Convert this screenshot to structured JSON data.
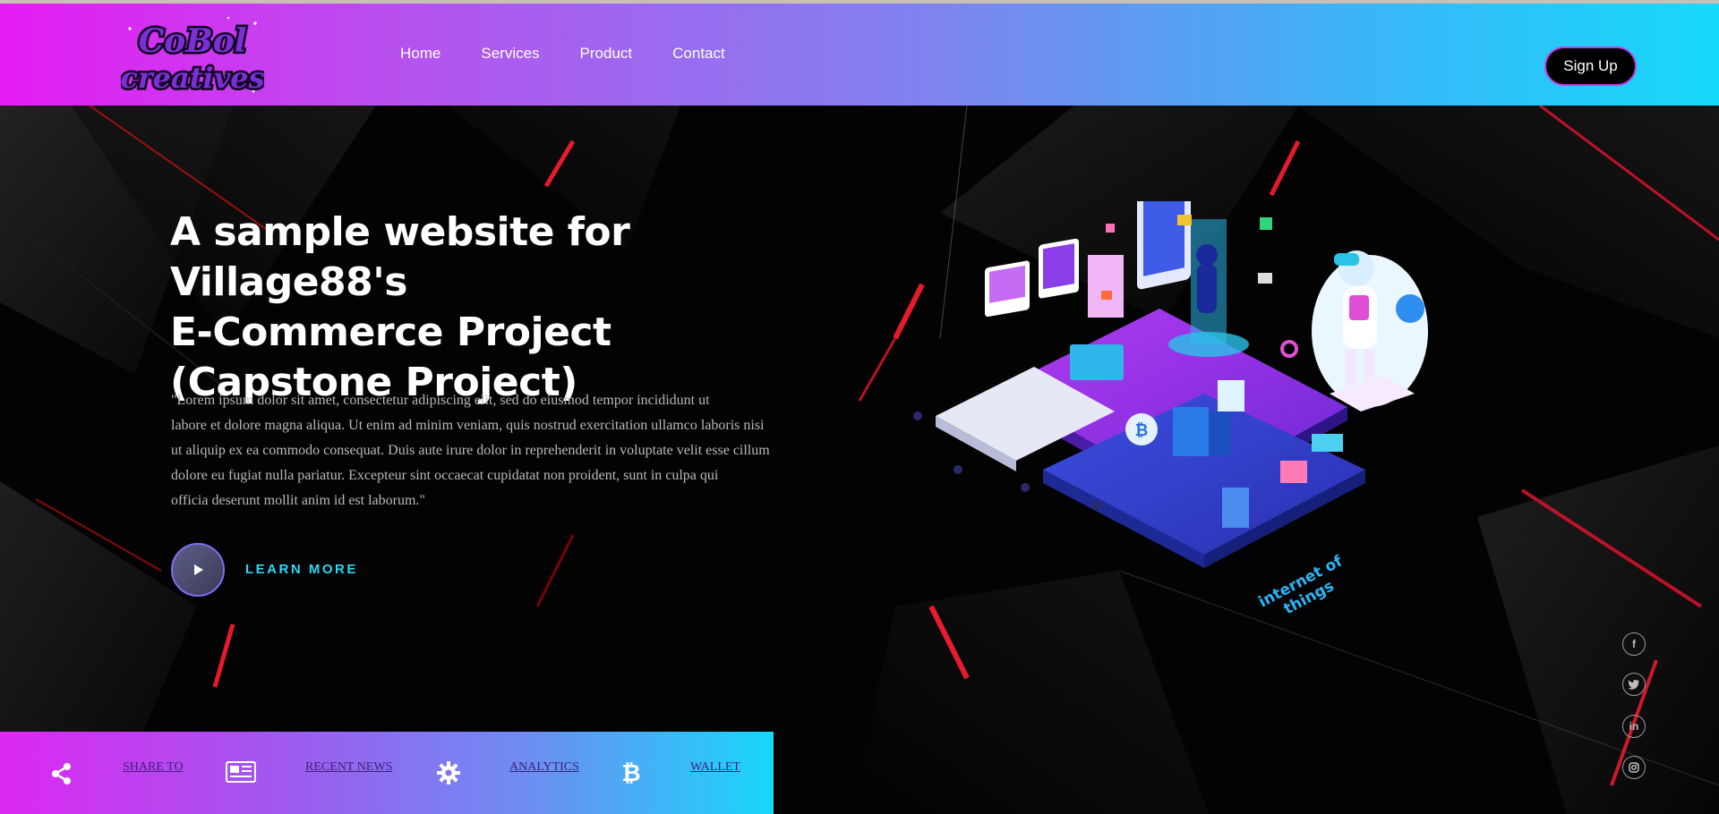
{
  "header": {
    "logo_text_line1": "CoBol",
    "logo_text_line2": "creatives",
    "nav": [
      "Home",
      "Services",
      "Product",
      "Contact"
    ],
    "signup_label": "Sign Up"
  },
  "hero": {
    "headline_line1": "A sample website for Village88's",
    "headline_line2": "E-Commerce Project",
    "headline_line3": "(Capstone Project)",
    "paragraph_lines": [
      "\"Lorem ipsum dolor sit amet, consectetur adipiscing elit, sed do eiusmod tempor incididunt ut",
      "labore et dolore magna aliqua. Ut enim ad minim veniam, quis nostrud exercitation ullamco laboris nisi",
      "ut aliquip ex ea commodo consequat. Duis aute irure dolor in reprehenderit in voluptate velit esse cillum",
      "dolore eu fugiat nulla pariatur. Excepteur sint occaecat cupidatat non proident, sunt in culpa qui",
      "officia deserunt mollit anim id est laborum.\""
    ],
    "learn_more_label": "LEARN MORE",
    "illustration_caption_line1": "internet of",
    "illustration_caption_line2": "things"
  },
  "bottom_bar": {
    "items": [
      {
        "label": "SHARE TO",
        "icon": "share-icon"
      },
      {
        "label": "RECENT NEWS",
        "icon": "newspaper-icon"
      },
      {
        "label": "ANALYTICS",
        "icon": "gear-icon"
      },
      {
        "label": "WALLET",
        "icon": "bitcoin-icon"
      }
    ]
  },
  "social": {
    "facebook_glyph": "f",
    "linkedin_glyph": "in"
  },
  "colors": {
    "header_gradient_start": "#e61cf2",
    "header_gradient_end": "#16d9f9",
    "accent_cyan": "#2ad8f7",
    "accent_red": "#e3112e"
  }
}
